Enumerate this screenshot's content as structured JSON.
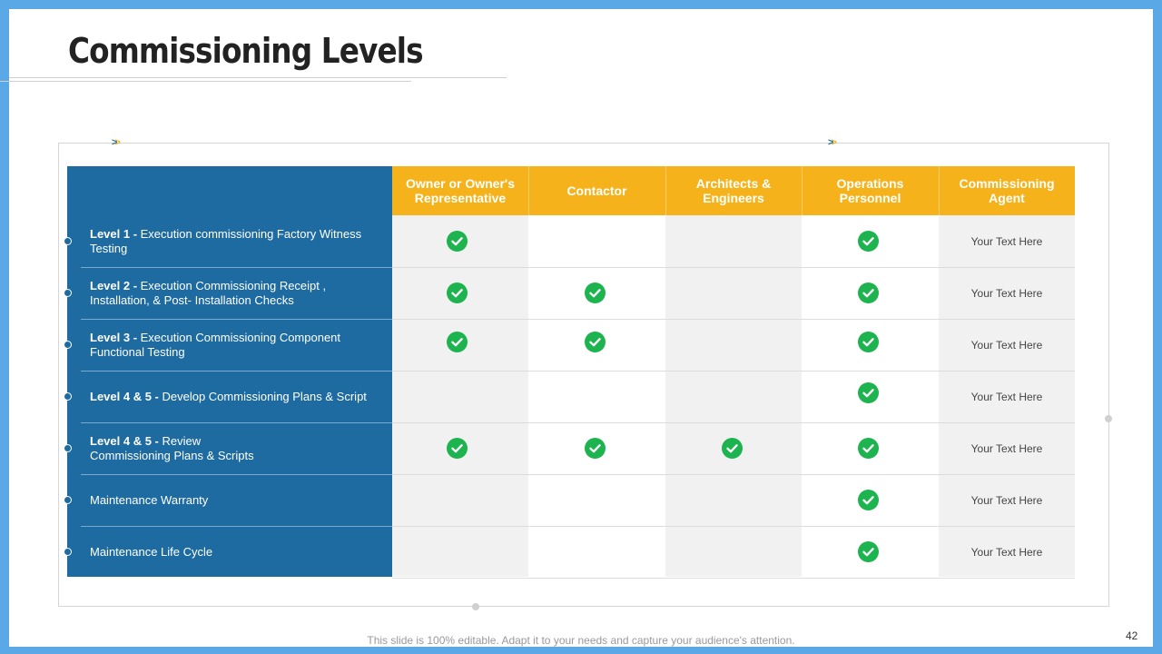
{
  "title": "Commissioning Levels",
  "columns": [
    {
      "label": "Owner or Owner's Representative"
    },
    {
      "label": "Contactor"
    },
    {
      "label": "Architects & Engineers"
    },
    {
      "label": "Operations Personnel"
    },
    {
      "label": "Commissioning Agent"
    }
  ],
  "rows": [
    {
      "prefix": "Level 1 - ",
      "text": "Execution commissioning Factory Witness Testing",
      "checks": [
        true,
        false,
        false,
        true
      ],
      "agent": "Your Text Here"
    },
    {
      "prefix": "Level 2 - ",
      "text": "Execution Commissioning Receipt , Installation, & Post- Installation Checks",
      "checks": [
        true,
        true,
        false,
        true
      ],
      "agent": "Your Text Here"
    },
    {
      "prefix": "Level 3 - ",
      "text": "Execution Commissioning Component Functional Testing",
      "checks": [
        true,
        true,
        false,
        true
      ],
      "agent": "Your Text Here"
    },
    {
      "prefix": "Level 4 & 5 - ",
      "text": "Develop Commissioning Plans & Script",
      "checks": [
        false,
        false,
        false,
        true
      ],
      "agent": "Your Text Here"
    },
    {
      "prefix": "Level 4 & 5 - ",
      "text": "Review Commissioning Plans & Scripts",
      "checks": [
        true,
        true,
        true,
        true
      ],
      "agent": "Your Text Here"
    },
    {
      "prefix": "",
      "text": "Maintenance Warranty",
      "checks": [
        false,
        false,
        false,
        true
      ],
      "agent": "Your Text Here"
    },
    {
      "prefix": "",
      "text": "Maintenance Life Cycle",
      "checks": [
        false,
        false,
        false,
        true
      ],
      "agent": "Your Text Here"
    }
  ],
  "footer": "This slide is 100% editable. Adapt it to your needs and capture your audience's attention.",
  "page_number": "42",
  "colors": {
    "border": "#5aa9e6",
    "panel_blue": "#1e6ba1",
    "header_orange": "#f5b21b",
    "check_green": "#1db34f",
    "shaded_column": "#f1f1f1"
  },
  "icons": {
    "check": "check-circle-icon",
    "arrows": "double-chevron-right-icon"
  }
}
